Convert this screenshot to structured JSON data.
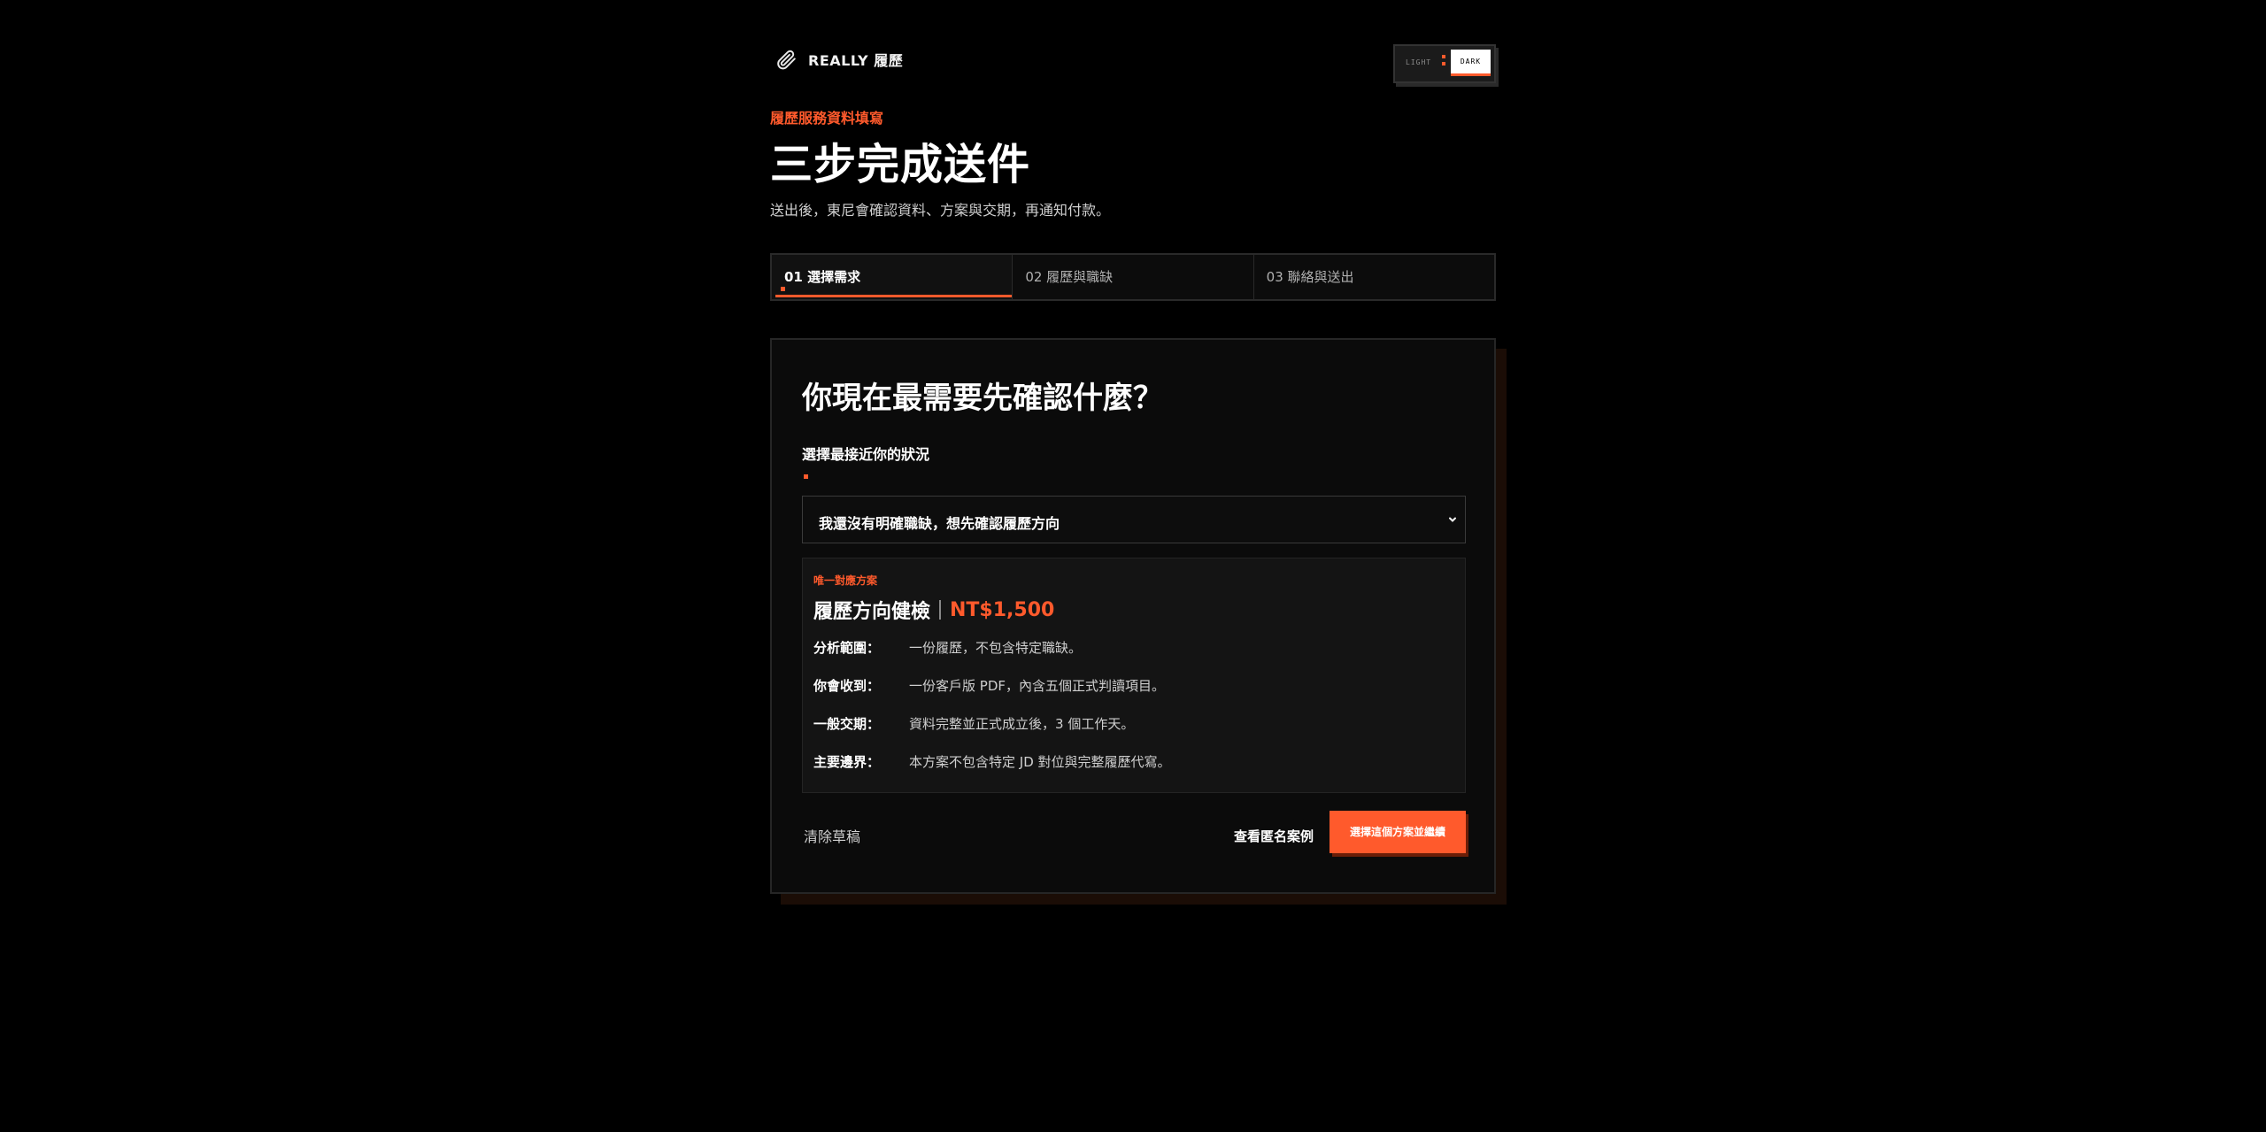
{
  "brand": {
    "name": "REALLY 履歷"
  },
  "theme_toggle": {
    "light_label": "LIGHT",
    "dark_label": "DARK"
  },
  "header": {
    "eyebrow": "履歷服務資料填寫",
    "title": "三步完成送件",
    "subtitle": "送出後，東尼會確認資料、方案與交期，再通知付款。"
  },
  "steps": [
    {
      "label": "01 選擇需求"
    },
    {
      "label": "02 履歷與職缺"
    },
    {
      "label": "03 聯絡與送出"
    }
  ],
  "card": {
    "title": "你現在最需要先確認什麼？",
    "field_label": "選擇最接近你的狀況",
    "select_value": "我還沒有明確職缺，想先確認履歷方向",
    "plan": {
      "tag": "唯一對應方案",
      "name": "履歷方向健檢",
      "price": "NT$1,500",
      "rows": [
        {
          "key": "分析範圍：",
          "value": "一份履歷，不包含特定職缺。"
        },
        {
          "key": "你會收到：",
          "value": "一份客戶版 PDF，內含五個正式判讀項目。"
        },
        {
          "key": "一般交期：",
          "value": "資料完整並正式成立後，3 個工作天。"
        },
        {
          "key": "主要邊界：",
          "value": "本方案不包含特定 JD 對位與完整履歷代寫。"
        }
      ]
    },
    "clear_label": "清除草稿",
    "example_label": "查看匿名案例",
    "primary_label": "選擇這個方案並繼續"
  },
  "colors": {
    "accent": "#ff5a2c",
    "background": "#000000",
    "card": "#0b0b0b"
  }
}
